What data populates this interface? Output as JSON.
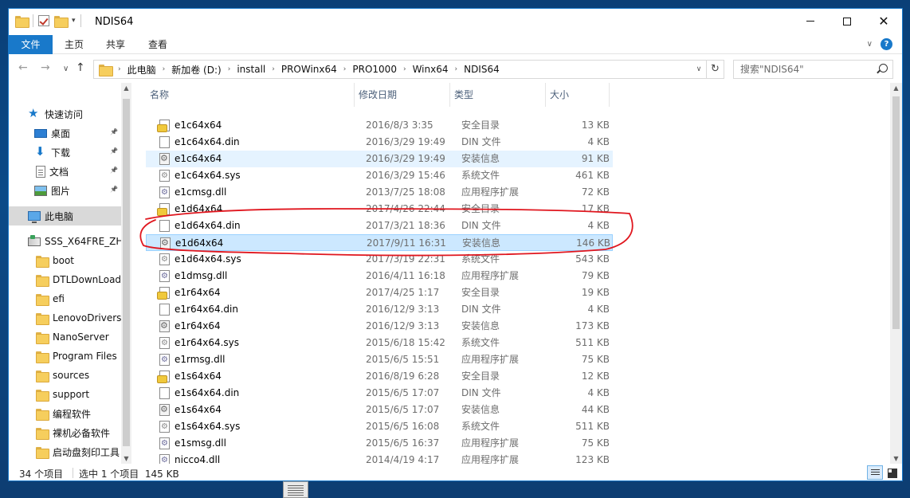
{
  "window": {
    "title": "NDIS64",
    "controls": {
      "minimize": "—",
      "maximize": "☐",
      "close": "✕"
    }
  },
  "ribbon": {
    "tabs": [
      "文件",
      "主页",
      "共享",
      "查看"
    ]
  },
  "address": {
    "crumbs": [
      "此电脑",
      "新加卷 (D:)",
      "install",
      "PROWinx64",
      "PRO1000",
      "Winx64",
      "NDIS64"
    ],
    "refresh_icon": "↻"
  },
  "search": {
    "placeholder": "搜索\"NDIS64\""
  },
  "nav": {
    "back": "←",
    "forward": "→",
    "recent": "∨",
    "up": "↑"
  },
  "sidebar": {
    "items": [
      {
        "label": "快速访问",
        "icon": "star-icon"
      },
      {
        "label": "桌面",
        "icon": "desktop-icon",
        "pinned": true
      },
      {
        "label": "下载",
        "icon": "download-icon",
        "pinned": true
      },
      {
        "label": "文档",
        "icon": "document-icon",
        "pinned": true
      },
      {
        "label": "图片",
        "icon": "pictures-icon",
        "pinned": true
      },
      {
        "label": "此电脑",
        "icon": "computer-icon"
      },
      {
        "label": "SSS_X64FRE_ZH-",
        "icon": "drive-icon"
      },
      {
        "label": "boot",
        "icon": "folder-icon"
      },
      {
        "label": "DTLDownLoads",
        "icon": "folder-icon"
      },
      {
        "label": "efi",
        "icon": "folder-icon"
      },
      {
        "label": "LenovoDrivers",
        "icon": "folder-icon"
      },
      {
        "label": "NanoServer",
        "icon": "folder-icon"
      },
      {
        "label": "Program Files",
        "icon": "folder-icon"
      },
      {
        "label": "sources",
        "icon": "folder-icon"
      },
      {
        "label": "support",
        "icon": "folder-icon"
      },
      {
        "label": "编程软件",
        "icon": "folder-icon"
      },
      {
        "label": "裸机必备软件",
        "icon": "folder-icon"
      },
      {
        "label": "启动盘刻印工具",
        "icon": "folder-icon"
      }
    ]
  },
  "columns": [
    "名称",
    "修改日期",
    "类型",
    "大小"
  ],
  "files": [
    {
      "name": "e1c64x64",
      "date": "2016/8/3 3:35",
      "type": "安全目录",
      "size": "13 KB",
      "kind": "cat"
    },
    {
      "name": "e1c64x64.din",
      "date": "2016/3/29 19:49",
      "type": "DIN 文件",
      "size": "4 KB",
      "kind": "din"
    },
    {
      "name": "e1c64x64",
      "date": "2016/3/29 19:49",
      "type": "安装信息",
      "size": "91 KB",
      "kind": "inf"
    },
    {
      "name": "e1c64x64.sys",
      "date": "2016/3/29 15:46",
      "type": "系统文件",
      "size": "461 KB",
      "kind": "sys"
    },
    {
      "name": "e1cmsg.dll",
      "date": "2013/7/25 18:08",
      "type": "应用程序扩展",
      "size": "72 KB",
      "kind": "dll"
    },
    {
      "name": "e1d64x64",
      "date": "2017/4/26 22:44",
      "type": "安全目录",
      "size": "17 KB",
      "kind": "cat"
    },
    {
      "name": "e1d64x64.din",
      "date": "2017/3/21 18:36",
      "type": "DIN 文件",
      "size": "4 KB",
      "kind": "din"
    },
    {
      "name": "e1d64x64",
      "date": "2017/9/11 16:31",
      "type": "安装信息",
      "size": "146 KB",
      "kind": "inf"
    },
    {
      "name": "e1d64x64.sys",
      "date": "2017/3/19 22:31",
      "type": "系统文件",
      "size": "543 KB",
      "kind": "sys"
    },
    {
      "name": "e1dmsg.dll",
      "date": "2016/4/11 16:18",
      "type": "应用程序扩展",
      "size": "79 KB",
      "kind": "dll"
    },
    {
      "name": "e1r64x64",
      "date": "2017/4/25 1:17",
      "type": "安全目录",
      "size": "19 KB",
      "kind": "cat"
    },
    {
      "name": "e1r64x64.din",
      "date": "2016/12/9 3:13",
      "type": "DIN 文件",
      "size": "4 KB",
      "kind": "din"
    },
    {
      "name": "e1r64x64",
      "date": "2016/12/9 3:13",
      "type": "安装信息",
      "size": "173 KB",
      "kind": "inf"
    },
    {
      "name": "e1r64x64.sys",
      "date": "2015/6/18 15:42",
      "type": "系统文件",
      "size": "511 KB",
      "kind": "sys"
    },
    {
      "name": "e1rmsg.dll",
      "date": "2015/6/5 15:51",
      "type": "应用程序扩展",
      "size": "75 KB",
      "kind": "dll"
    },
    {
      "name": "e1s64x64",
      "date": "2016/8/19 6:28",
      "type": "安全目录",
      "size": "12 KB",
      "kind": "cat"
    },
    {
      "name": "e1s64x64.din",
      "date": "2015/6/5 17:07",
      "type": "DIN 文件",
      "size": "4 KB",
      "kind": "din"
    },
    {
      "name": "e1s64x64",
      "date": "2015/6/5 17:07",
      "type": "安装信息",
      "size": "44 KB",
      "kind": "inf"
    },
    {
      "name": "e1s64x64.sys",
      "date": "2015/6/5 16:08",
      "type": "系统文件",
      "size": "511 KB",
      "kind": "sys"
    },
    {
      "name": "e1smsg.dll",
      "date": "2015/6/5 16:37",
      "type": "应用程序扩展",
      "size": "75 KB",
      "kind": "dll"
    },
    {
      "name": "nicco4.dll",
      "date": "2014/4/19 4:17",
      "type": "应用程序扩展",
      "size": "123 KB",
      "kind": "dll"
    }
  ],
  "hovered_row": 2,
  "selected_row": 7,
  "status": {
    "count": "34 个项目",
    "selection": "选中 1 个项目  145 KB"
  },
  "colors": {
    "accent": "#1979ca",
    "selected_row": "#cce8ff",
    "hover_row": "#e5f3ff",
    "annotation": "#e0161e"
  }
}
